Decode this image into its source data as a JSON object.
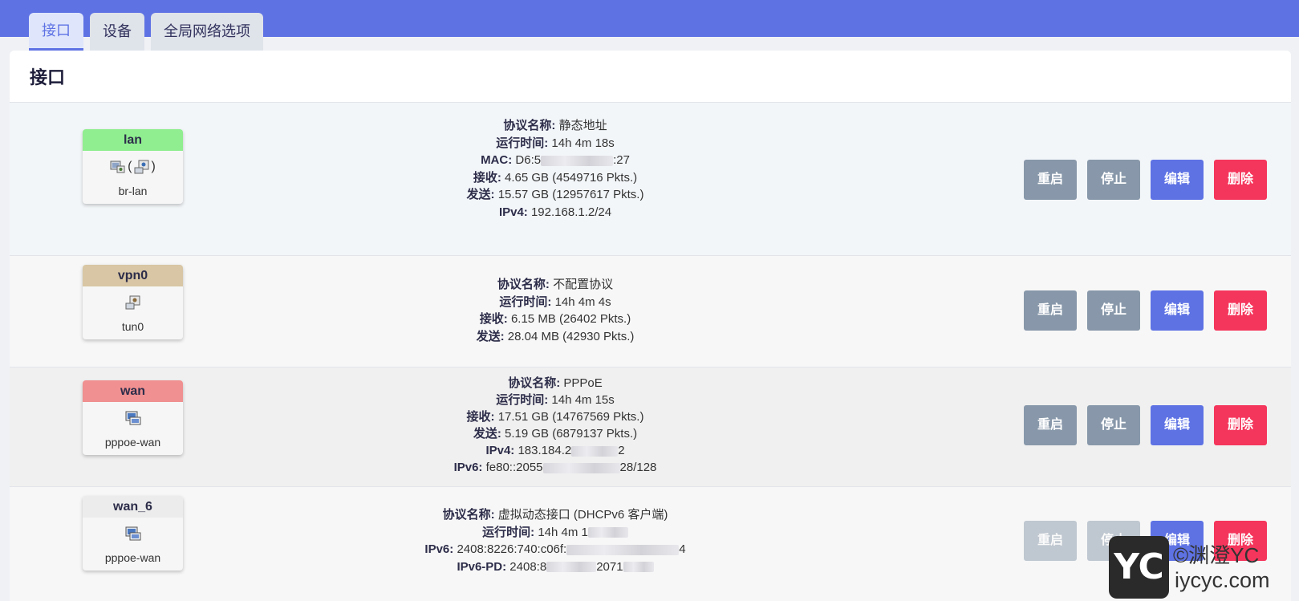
{
  "tabs": [
    "接口",
    "设备",
    "全局网络选项"
  ],
  "panel_title": "接口",
  "buttons": {
    "restart": "重启",
    "stop": "停止",
    "edit": "编辑",
    "delete": "删除"
  },
  "colors": {
    "topbar": "#5e72e4",
    "lan": "#90ee90",
    "vpn0": "#d8c6a4",
    "wan": "#f09090",
    "wan_6": "#ececec"
  },
  "interfaces": [
    {
      "name": "lan",
      "icons": [
        "network-adapter-icon",
        "bridge-icon"
      ],
      "bridge_paren_open": "(",
      "bridge_paren_close": ")",
      "device": "br-lan",
      "lines": [
        {
          "k": "协议名称:",
          "v": "静态地址"
        },
        {
          "k": "运行时间:",
          "v": "14h 4m 18s"
        },
        {
          "k": "MAC:",
          "v": "D6:5",
          "tail": ":27"
        },
        {
          "k": "接收:",
          "v": "4.65 GB (4549716 Pkts.)"
        },
        {
          "k": "发送:",
          "v": "15.57 GB (12957617 Pkts.)"
        },
        {
          "k": "IPv4:",
          "v": "192.168.1.2/24"
        }
      ]
    },
    {
      "name": "vpn0",
      "icons": [
        "network-adapter-icon"
      ],
      "device": "tun0",
      "lines": [
        {
          "k": "协议名称:",
          "v": "不配置协议"
        },
        {
          "k": "运行时间:",
          "v": "14h 4m 4s"
        },
        {
          "k": "接收:",
          "v": "6.15 MB (26402 Pkts.)"
        },
        {
          "k": "发送:",
          "v": "28.04 MB (42930 Pkts.)"
        }
      ]
    },
    {
      "name": "wan",
      "icons": [
        "pppoe-icon"
      ],
      "device": "pppoe-wan",
      "lines": [
        {
          "k": "协议名称:",
          "v": "PPPoE"
        },
        {
          "k": "运行时间:",
          "v": "14h 4m 15s"
        },
        {
          "k": "接收:",
          "v": "17.51 GB (14767569 Pkts.)"
        },
        {
          "k": "发送:",
          "v": "5.19 GB (6879137 Pkts.)"
        },
        {
          "k": "IPv4:",
          "v": "183.184.2",
          "tail": "2"
        },
        {
          "k": "IPv6:",
          "v": "fe80::2055",
          "tail": "28/128"
        }
      ]
    },
    {
      "name": "wan_6",
      "icons": [
        "pppoe-icon"
      ],
      "device": "pppoe-wan",
      "lines": [
        {
          "k": "协议名称:",
          "v": "虚拟动态接口 (DHCPv6 客户端)"
        },
        {
          "k": "运行时间:",
          "v": "14h 4m 1"
        },
        {
          "k": "IPv6:",
          "v": "2408:8226:740:c06f:",
          "tail": "4"
        },
        {
          "k": "IPv6-PD:",
          "v": "2408:8",
          "tail": "2071"
        }
      ]
    }
  ],
  "watermark": {
    "logo": "YC",
    "line1": "©渊澄YC",
    "line2": "iycyc.com"
  }
}
